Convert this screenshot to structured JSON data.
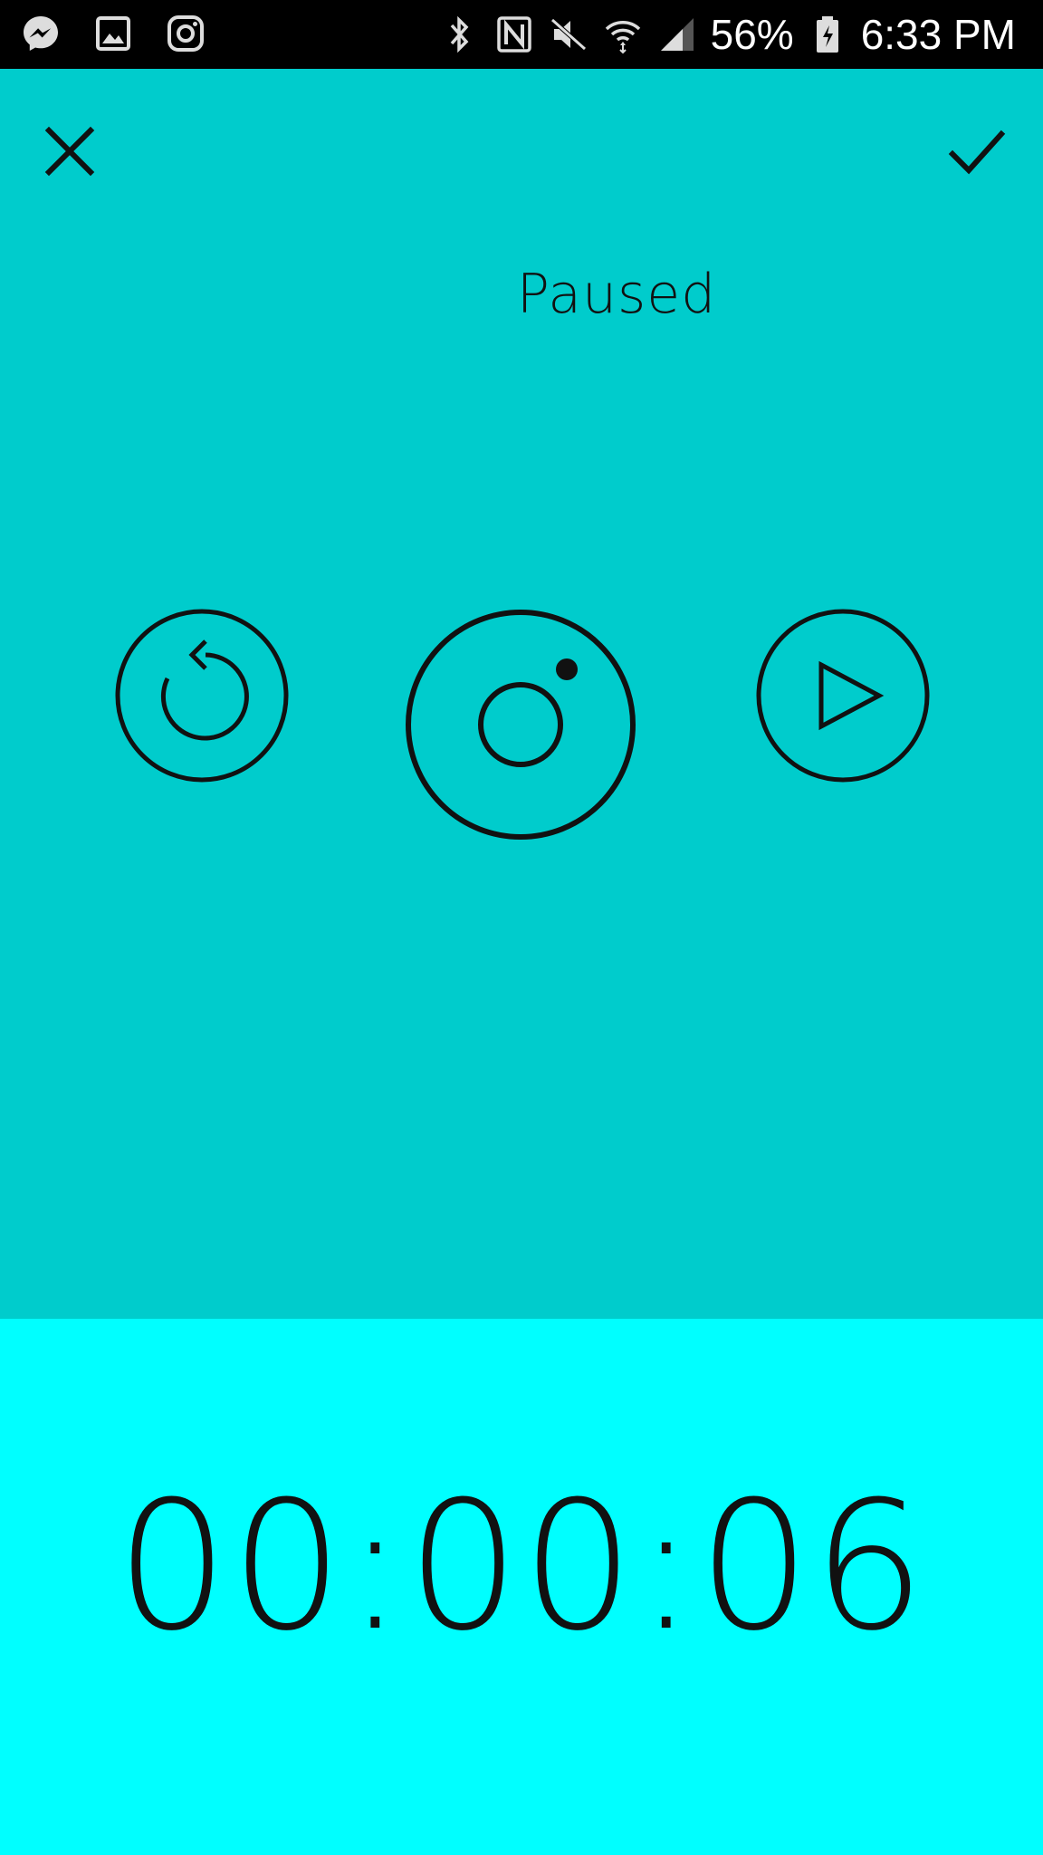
{
  "status_bar": {
    "left_icons": [
      "messenger-icon",
      "gallery-icon",
      "instagram-icon"
    ],
    "right_icons": [
      "bluetooth-icon",
      "nfc-icon",
      "mute-icon",
      "wifi-icon",
      "signal-icon",
      "battery-icon"
    ],
    "battery_percent": "56%",
    "time": "6:33 PM"
  },
  "header": {
    "close_icon": "close-icon",
    "confirm_icon": "check-icon"
  },
  "recorder": {
    "status": "Paused",
    "controls": [
      "reset-icon",
      "record-icon",
      "play-icon"
    ]
  },
  "timer": {
    "elapsed": "00:00:06"
  },
  "colors": {
    "main_bg": "#00CCCC",
    "timer_bg": "#00FFFF",
    "stroke": "#111111",
    "status_bar_bg": "#000000"
  }
}
